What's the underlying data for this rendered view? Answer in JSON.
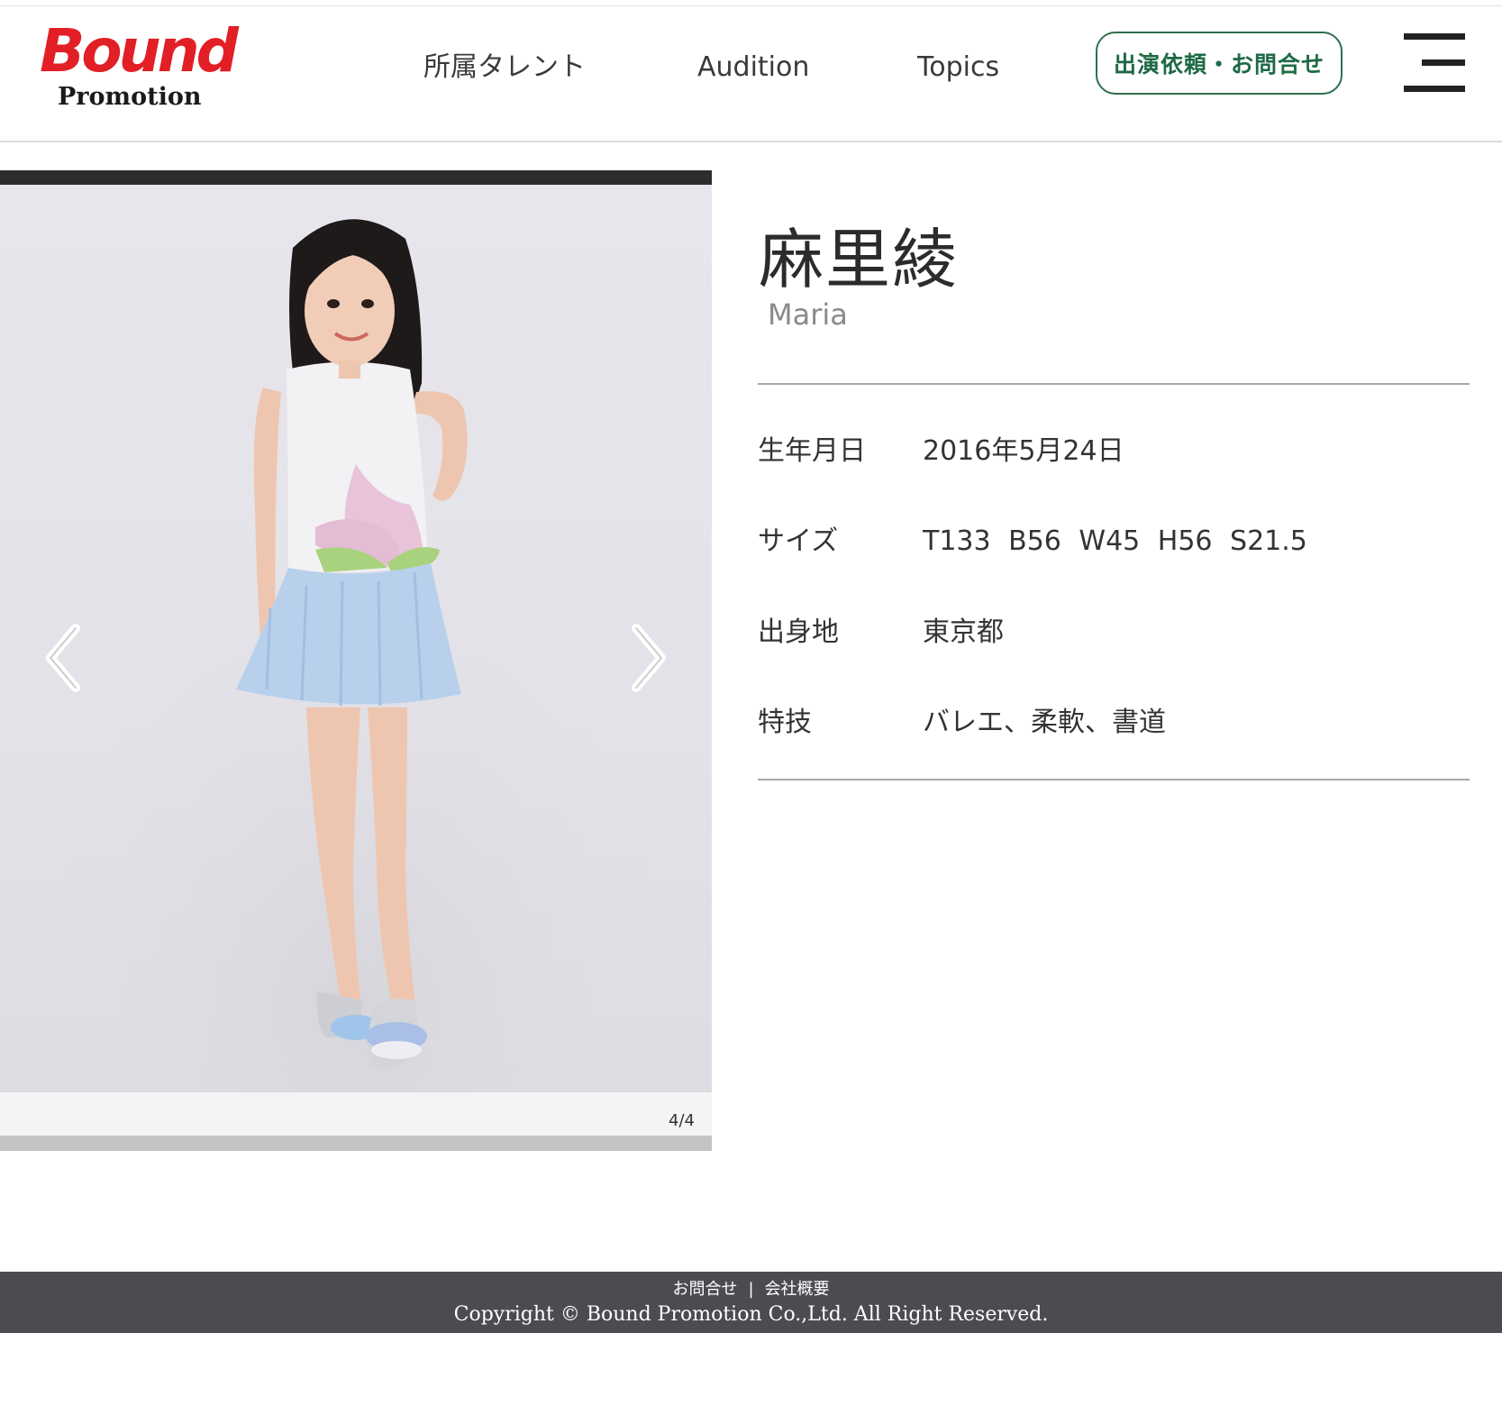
{
  "header": {
    "logo_word": "Bound",
    "logo_sub": "Promotion",
    "nav": [
      "所属タレント",
      "Audition",
      "Topics"
    ],
    "cta_label": "出演依頼・お問合せ",
    "menu_icon": "hamburger-menu-icon"
  },
  "gallery": {
    "counter": "4/4",
    "prev_icon": "chevron-left-icon",
    "next_icon": "chevron-right-icon"
  },
  "profile": {
    "name_ja": "麻里綾",
    "name_en": "Maria",
    "rows": [
      {
        "label": "生年月日",
        "value": "2016年5月24日"
      },
      {
        "label": "サイズ",
        "value": "T133 B56 W45 H56 S21.5"
      },
      {
        "label": "出身地",
        "value": "東京都"
      },
      {
        "label": "特技",
        "value": "バレエ、柔軟、書道"
      }
    ]
  },
  "footer": {
    "links": [
      "お問合せ",
      "会社概要"
    ],
    "separator": "|",
    "copyright": "Copyright © Bound Promotion Co.,Ltd. All Right Reserved."
  },
  "colors": {
    "brand_red": "#e21f26",
    "cta_green": "#1f6a45",
    "footer_bg": "#4b4c50"
  }
}
